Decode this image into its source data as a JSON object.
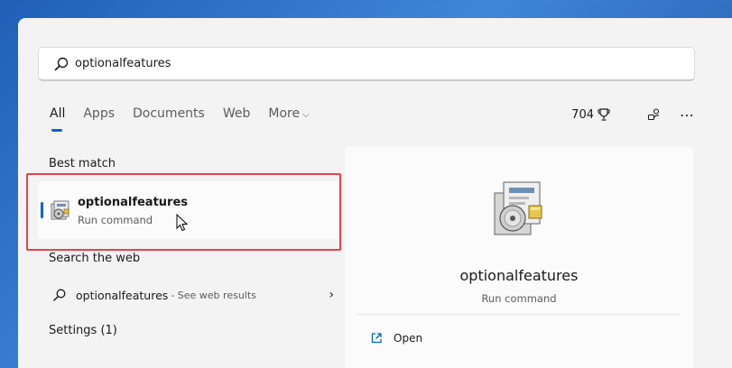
{
  "search": {
    "value": "optionalfeatures"
  },
  "tabs": [
    {
      "label": "All"
    },
    {
      "label": "Apps"
    },
    {
      "label": "Documents"
    },
    {
      "label": "Web"
    },
    {
      "label": "More"
    }
  ],
  "rewards": {
    "points": "704"
  },
  "sections": {
    "best_match": "Best match",
    "search_web": "Search the web",
    "settings": "Settings (1)"
  },
  "best_match_item": {
    "title": "optionalfeatures",
    "subtitle": "Run command"
  },
  "web_item": {
    "label": "optionalfeatures",
    "hint": "- See web results"
  },
  "details": {
    "name": "optionalfeatures",
    "type": "Run command",
    "open_label": "Open"
  },
  "colors": {
    "accent": "#0067c0",
    "highlight": "#e0464b"
  }
}
